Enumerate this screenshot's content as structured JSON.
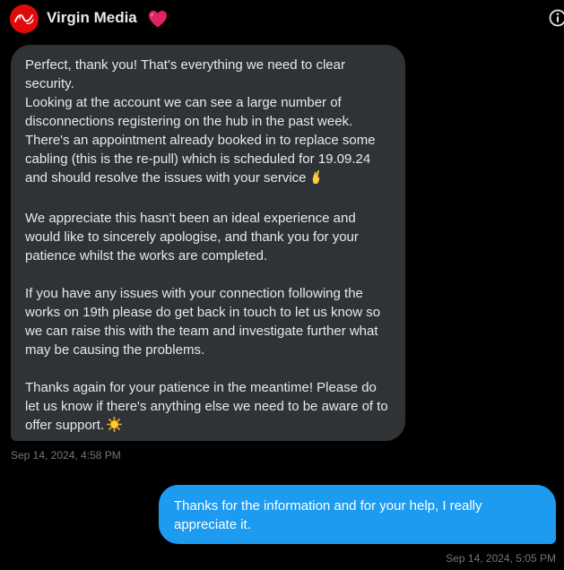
{
  "header": {
    "name": "Virgin Media",
    "avatar_icon": "virgin-logo-icon",
    "badge_icon": "red-heart-icon",
    "info_icon": "info-icon",
    "brand_color": "#e10a0a"
  },
  "conversation": {
    "incoming": {
      "paragraphs": [
        "Perfect, thank you! That's everything we need to clear security.",
        "Looking at the account we can see a large number of disconnections registering on the hub in the past week. There's an appointment already booked in to replace some cabling (this is the re-pull) which is scheduled for 19.09.24 and should resolve the issues with your service",
        "We appreciate this hasn't been an ideal experience and would like to sincerely apologise, and thank you for your patience whilst the works are completed.",
        "If you have any issues with your connection following the works on 19th please do get back in touch to let us know so we can raise this with the team and investigate further what may be causing the problems.",
        "Thanks again for your patience in the meantime! Please do let us know if there's anything else we need to be aware of to offer support."
      ],
      "emoji_1": "crossed-fingers-emoji",
      "emoji_2": "sun-emoji",
      "timestamp": "Sep 14, 2024, 4:58 PM",
      "bubble_color": "#2f3336"
    },
    "outgoing": {
      "text": "Thanks for the information and for your help, I really appreciate it.",
      "timestamp": "Sep 14, 2024, 5:05 PM",
      "bubble_color": "#1d9bf0"
    }
  }
}
